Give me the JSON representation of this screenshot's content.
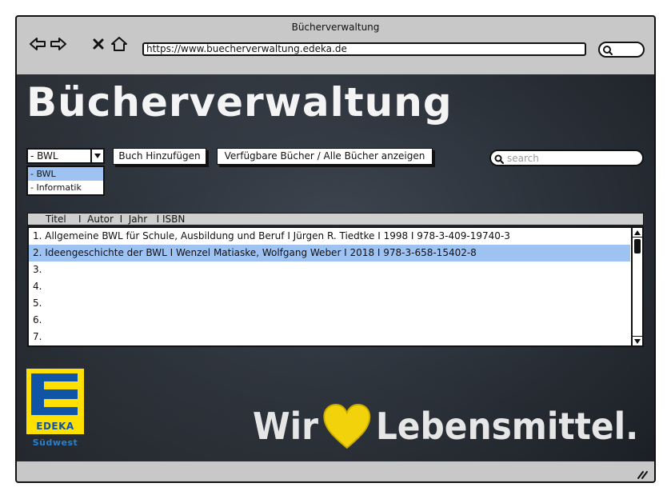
{
  "window": {
    "title": "Bücherverwaltung",
    "url": "https://www.buecherverwaltung.edeka.de"
  },
  "page": {
    "heading": "Bücherverwaltung"
  },
  "category_select": {
    "selected": "- BWL",
    "options": [
      "- BWL",
      "- Informatik"
    ]
  },
  "toolbar": {
    "add_book_label": "Buch Hinzufügen",
    "toggle_view_label": "Verfügbare Bücher / Alle Bücher anzeigen"
  },
  "search": {
    "placeholder": "search"
  },
  "table": {
    "header": "Titel    I  Autor  I  Jahr   I ISBN",
    "rows": [
      "1. Allgemeine BWL für Schule, Ausbildung und Beruf I Jürgen R. Tiedtke  I 1998 I 978-3-409-19740-3",
      "2. Ideengeschichte der BWL I Wenzel Matiaske, Wolfgang Weber I 2018 I 978-3-658-15402-8",
      "3.",
      "4.",
      "5.",
      "6.",
      "7."
    ]
  },
  "branding": {
    "logo_name": "EDEKA",
    "logo_region": "Südwest",
    "slogan_left": "Wir",
    "slogan_right": "Lebensmittel.",
    "colors": {
      "edeka_yellow": "#ffe000",
      "edeka_blue": "#1055a5",
      "heart_yellow": "#f2d20a"
    }
  },
  "icons": {
    "back": "arrow-left-icon",
    "forward": "arrow-right-icon",
    "close": "close-icon",
    "home": "home-icon",
    "search": "search-icon",
    "dropdown": "chevron-down-icon",
    "heart": "heart-icon",
    "resize": "resize-grip-icon"
  },
  "colors": {
    "selection": "#9ec2f2",
    "chalkboard": "#2a3038"
  }
}
